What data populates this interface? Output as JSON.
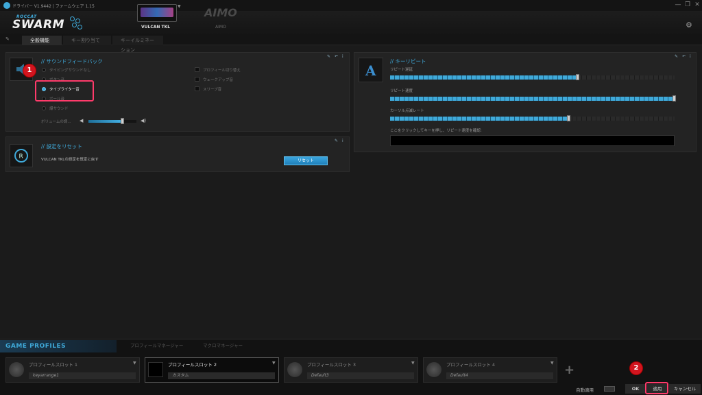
{
  "window": {
    "title": "ドライバー V1.9442 | ファームウェア 1.15",
    "controls": [
      "—",
      "❐",
      "✕"
    ]
  },
  "brand": {
    "roccat": "ROCCAT",
    "swarm": "SWARM"
  },
  "devices": [
    {
      "label": "VULCAN TKL"
    },
    {
      "logo": "AIMO",
      "label": "AIMO"
    }
  ],
  "tabs": [
    "全般機能",
    "キー割り当て",
    "キーイルミネーション"
  ],
  "sound_feedback": {
    "title": "// サウンドフィードバック",
    "options": [
      "タイピングサウンドなし",
      "ボタン音",
      "タイプライター音",
      "ボール音",
      "爆サウンド"
    ],
    "selected_index": 2,
    "volume_label": "ボリュームの調...",
    "volume_level": 0.72,
    "checks": [
      "プロフィール切り替え",
      "ウェークアップ音",
      "スリープ音"
    ]
  },
  "reset_panel": {
    "title": "// 設定をリセット",
    "description": "VULCAN TKLの設定を既定に戻す",
    "button": "リセット"
  },
  "key_repeat": {
    "title": "// キーリピート",
    "repeat_delay_label": "リピート遅延",
    "repeat_delay_level": 0.66,
    "repeat_rate_label": "リピート速度",
    "repeat_rate_level": 1.0,
    "cursor_blink_label": "カーソル点滅レート",
    "cursor_blink_level": 0.63,
    "test_label": "ここをクリックしてキーを押し、リピート速度を確認:"
  },
  "profiles": {
    "section_title": "GAME PROFILES",
    "tabs": [
      "プロフィールマネージャー",
      "マクロマネージャー"
    ],
    "slots": [
      {
        "title": "プロフィールスロット 1",
        "name": "keyarrange1",
        "active": false
      },
      {
        "title": "プロフィールスロット 2",
        "name": "カスタム",
        "active": true
      },
      {
        "title": "プロフィールスロット 3",
        "name": "Default3",
        "active": false
      },
      {
        "title": "プロフィールスロット 4",
        "name": "Default4",
        "active": false
      }
    ],
    "add": "+",
    "auto_apply": "自動適用"
  },
  "footer": {
    "ok": "OK",
    "apply": "適用",
    "cancel": "キャンセル"
  },
  "annotations": {
    "badge1": "1",
    "badge2": "2"
  },
  "colors": {
    "accent": "#3fa9d9",
    "highlight": "#ff3b6b",
    "badge": "#d2151f"
  }
}
